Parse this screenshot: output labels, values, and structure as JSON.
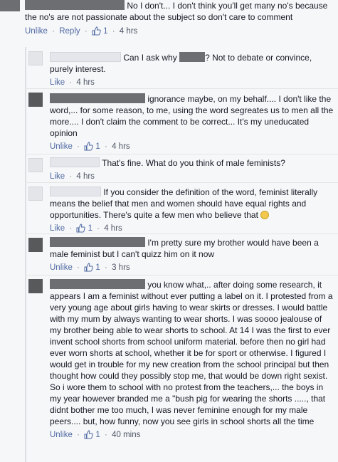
{
  "comments": {
    "c0": {
      "text": "No I don't... I don't think you'll get many no's because the no's are not passionate about the subject so don't care to comment",
      "like_label": "Unlike",
      "reply_label": "Reply",
      "likes": "1",
      "time": "4 hrs"
    },
    "c1": {
      "text": "? Not to debate or convince, purely interest.",
      "prefix": "Can I ask why",
      "like_label": "Like",
      "time": "4 hrs"
    },
    "c2": {
      "text": "ignorance maybe, on my behalf.... I don't like the word,... for some reason, to me, using the word segreates us to men all the more.... I don't claim the comment to be correct... It's my uneducated opinion",
      "like_label": "Unlike",
      "likes": "1",
      "time": "4 hrs"
    },
    "c3": {
      "text": "That's fine. What do you think of male feminists?",
      "like_label": "Like",
      "time": "4 hrs"
    },
    "c4": {
      "text": "If you consider the definition of the word, feminist literally means the belief that men and women should have equal rights and opportunities. There's quite a few men who believe that",
      "like_label": "Like",
      "likes": "1",
      "time": "4 hrs"
    },
    "c5": {
      "text": "I'm pretty sure my brother would have been a male feminist but I can't quizz him on it now",
      "like_label": "Unlike",
      "likes": "1",
      "time": "3 hrs"
    },
    "c6": {
      "text": "you know what,.. after doing some research, it appears I am a feminist without ever putting a label on it. I protested from a very young age about girls having to wear skirts or dresses. I would battle with my mum by always wanting to wear shorts. I was soooo jealouse of my brother being able to wear shorts to school. At 14 I was the first to ever invent school shorts from school uniform material. before then no girl had ever worn shorts at school, whether it be for sport or otherwise. I figured I would get in trouble for my new creation from the school principal but then thought how could they possibly stop me, that would be down right sexist. So i wore them to school with no protest from the teachers,... the boys in my year however branded me a \"bush pig for wearing the shorts ....., that didnt bother me too much, I was never feminine enough for my male peers.... but, how funny, now you see girls in school shorts all the time",
      "like_label": "Unlike",
      "likes": "1",
      "time": "40 mins"
    }
  },
  "colors": {
    "link": "#4e69a2",
    "redact_dark": "#6d6e71",
    "redact_light": "#e4e6eb"
  },
  "icons": {
    "like": "thumbs-up-icon",
    "smiley": "smiley-icon"
  }
}
